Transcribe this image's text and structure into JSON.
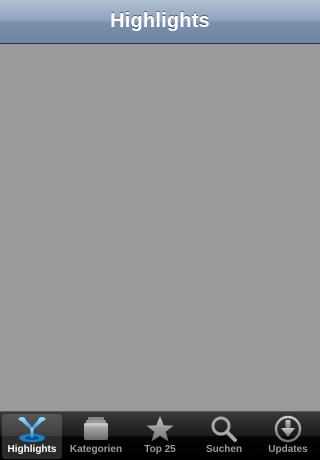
{
  "navbar": {
    "title": "Highlights"
  },
  "tabbar": {
    "selected_index": 0,
    "tabs": [
      {
        "label": "Highlights",
        "icon": "highlights-icon"
      },
      {
        "label": "Kategorien",
        "icon": "categories-icon"
      },
      {
        "label": "Top 25",
        "icon": "star-icon"
      },
      {
        "label": "Suchen",
        "icon": "search-icon"
      },
      {
        "label": "Updates",
        "icon": "download-arrow-icon"
      }
    ]
  },
  "colors": {
    "navbar_gradient_top": "#b3c2d5",
    "navbar_gradient_bottom": "#6e85a3",
    "content_background": "#9a9a9c",
    "tabbar_background": "#000000",
    "selected_icon_blue": "#3aa7e6",
    "inactive_gray": "#9b9b9b"
  }
}
